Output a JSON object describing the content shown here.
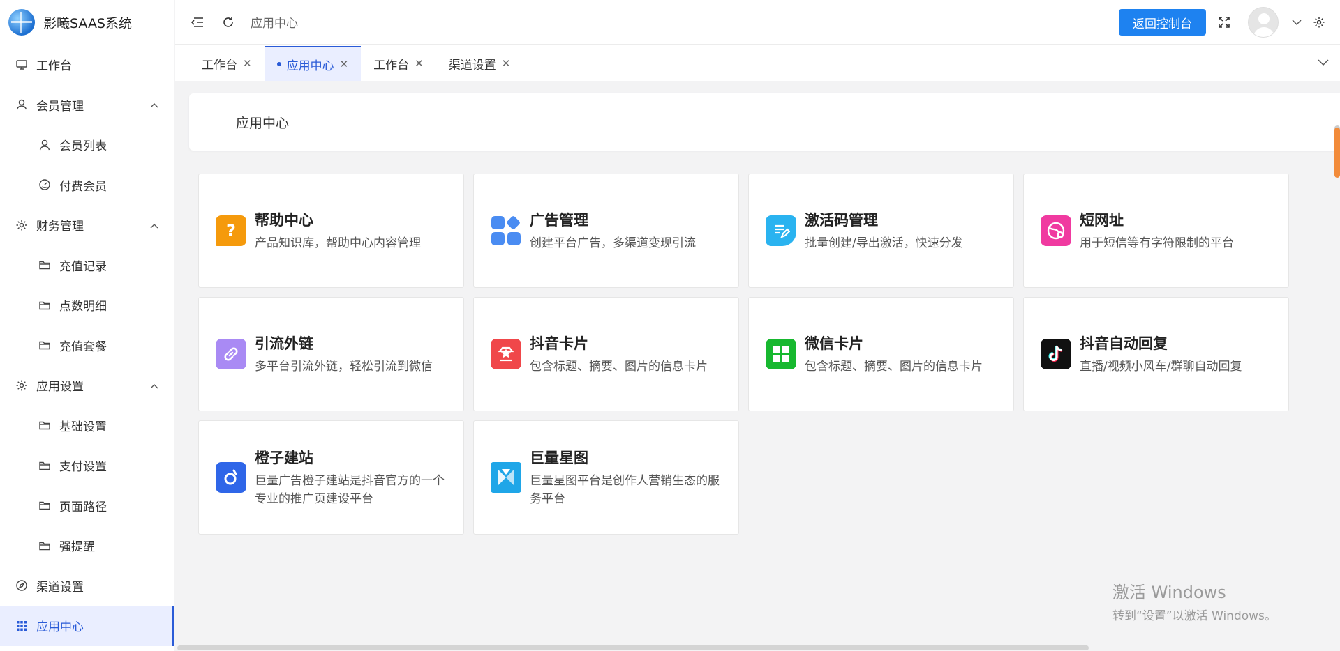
{
  "app": {
    "logo_text": "影曦SAAS系统"
  },
  "sidebar": {
    "items": [
      {
        "label": "工作台",
        "icon": "monitor-icon"
      },
      {
        "label": "会员管理",
        "icon": "user-icon",
        "expanded": true
      },
      {
        "label": "会员列表",
        "icon": "user-icon"
      },
      {
        "label": "付费会员",
        "icon": "dashboard-icon"
      },
      {
        "label": "财务管理",
        "icon": "gear-icon",
        "expanded": true
      },
      {
        "label": "充值记录",
        "icon": "folder-icon"
      },
      {
        "label": "点数明细",
        "icon": "folder-icon"
      },
      {
        "label": "充值套餐",
        "icon": "folder-icon"
      },
      {
        "label": "应用设置",
        "icon": "gear-icon",
        "expanded": true
      },
      {
        "label": "基础设置",
        "icon": "folder-icon"
      },
      {
        "label": "支付设置",
        "icon": "folder-icon"
      },
      {
        "label": "页面路径",
        "icon": "folder-icon"
      },
      {
        "label": "强提醒",
        "icon": "folder-icon"
      },
      {
        "label": "渠道设置",
        "icon": "compass-icon"
      },
      {
        "label": "应用中心",
        "icon": "grid-icon",
        "active": true
      }
    ]
  },
  "header": {
    "breadcrumb": "应用中心",
    "back_button": "返回控制台"
  },
  "tabs": [
    {
      "label": "工作台"
    },
    {
      "label": "应用中心",
      "active": true
    },
    {
      "label": "工作台"
    },
    {
      "label": "渠道设置"
    }
  ],
  "page": {
    "title": "应用中心"
  },
  "apps": [
    {
      "title": "帮助中心",
      "desc": "产品知识库，帮助中心内容管理",
      "icon": "help-icon",
      "color": "#f59a0c"
    },
    {
      "title": "广告管理",
      "desc": "创建平台广告，多渠道变现引流",
      "icon": "apps-icon",
      "color": "#4a8cf2"
    },
    {
      "title": "激活码管理",
      "desc": "批量创建/导出激活，快速分发",
      "icon": "edit-note-icon",
      "color": "#2ab3f0"
    },
    {
      "title": "短网址",
      "desc": "用于短信等有字符限制的平台",
      "icon": "short-link-icon",
      "color": "#f03aa0"
    },
    {
      "title": "引流外链",
      "desc": "多平台引流外链，轻松引流到微信",
      "icon": "link-icon",
      "color": "#a98af4"
    },
    {
      "title": "抖音卡片",
      "desc": "包含标题、摘要、图片的信息卡片",
      "icon": "card-icon",
      "color": "#f0474a"
    },
    {
      "title": "微信卡片",
      "desc": "包含标题、摘要、图片的信息卡片",
      "icon": "wechat-card-icon",
      "color": "#17b82f"
    },
    {
      "title": "抖音自动回复",
      "desc": "直播/视频小风车/群聊自动回复",
      "icon": "tiktok-icon",
      "color": "#111111"
    },
    {
      "title": "橙子建站",
      "desc": "巨量广告橙子建站是抖音官方的一个专业的推广页建设平台",
      "icon": "orange-site-icon",
      "color": "#2f66e8"
    },
    {
      "title": "巨量星图",
      "desc": "巨量星图平台是创作人营销生态的服务平台",
      "icon": "star-map-icon",
      "color": "#1fa6e8"
    }
  ],
  "watermark": {
    "line1": "激活 Windows",
    "line2": "转到“设置”以激活 Windows。"
  }
}
